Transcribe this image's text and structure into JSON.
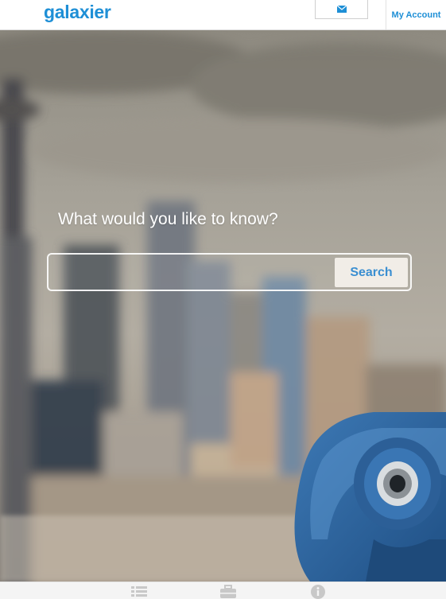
{
  "header": {
    "logo_text": "galaxier",
    "mail_icon": "envelope-icon",
    "account_label": "My Account"
  },
  "hero": {
    "headline": "What would you like to know?",
    "search": {
      "placeholder": "",
      "value": "",
      "button_label": "Search"
    }
  },
  "tabbar": {
    "tabs": [
      {
        "icon": "list-icon"
      },
      {
        "icon": "briefcase-icon"
      },
      {
        "icon": "info-icon"
      }
    ]
  },
  "colors": {
    "brand": "#1e8fd6",
    "search_button_text": "#3b8fd1",
    "search_button_bg": "#f1ede7",
    "tabbar_icon": "#c8c8c8"
  }
}
